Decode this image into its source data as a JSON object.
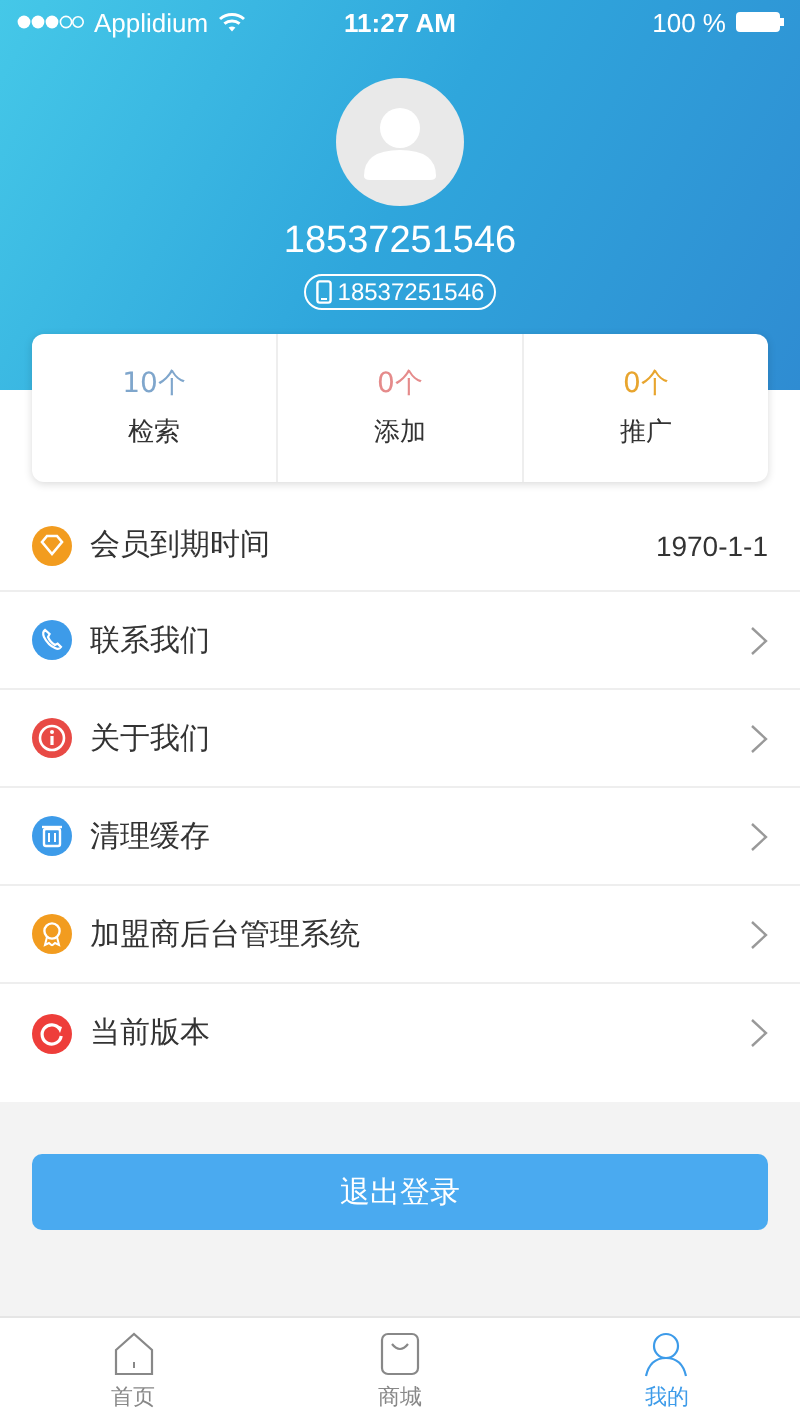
{
  "status_bar": {
    "carrier": "Applidium",
    "time": "11:27 AM",
    "battery": "100 %"
  },
  "profile": {
    "name": "18537251546",
    "phone": "18537251546"
  },
  "stats": [
    {
      "count": "10个",
      "label": "检索",
      "color": "#7fa6cc"
    },
    {
      "count": "0个",
      "label": "添加",
      "color": "#e58b8b"
    },
    {
      "count": "0个",
      "label": "推广",
      "color": "#e8a52e"
    }
  ],
  "menu": [
    {
      "kind": "diamond",
      "label": "会员到期时间",
      "value": "1970-1-1",
      "chevron": false,
      "color": "#f29c1f"
    },
    {
      "kind": "phone",
      "label": "联系我们",
      "chevron": true,
      "color": "#3d9be9"
    },
    {
      "kind": "info",
      "label": "关于我们",
      "chevron": true,
      "color": "#e84a45"
    },
    {
      "kind": "trash",
      "label": "清理缓存",
      "chevron": true,
      "color": "#3d9be9"
    },
    {
      "kind": "award",
      "label": "加盟商后台管理系统",
      "chevron": true,
      "color": "#f29c1f"
    },
    {
      "kind": "refresh",
      "label": "当前版本",
      "chevron": true,
      "color": "#ee3e3a"
    }
  ],
  "logout_button": "退出登录",
  "tabs": [
    {
      "kind": "home",
      "label": "首页",
      "selected": false
    },
    {
      "kind": "bag",
      "label": "商城",
      "selected": false
    },
    {
      "kind": "person",
      "label": "我的",
      "selected": true
    }
  ]
}
